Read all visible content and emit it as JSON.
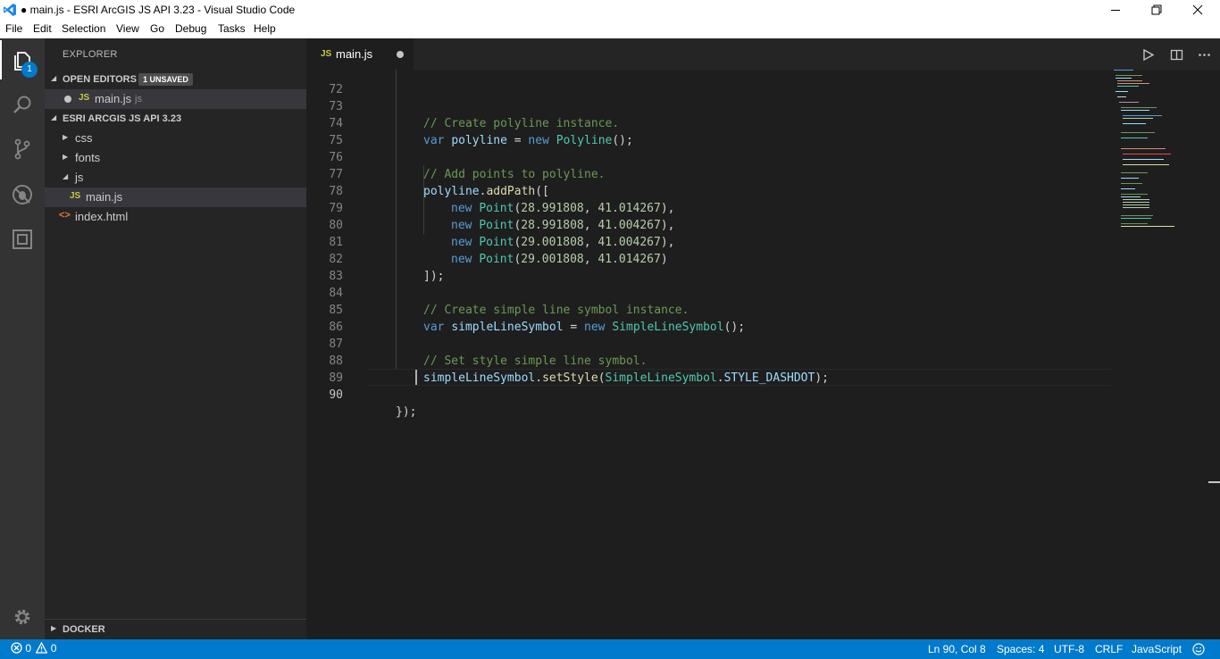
{
  "window": {
    "title": "● main.js - ESRI ArcGIS JS API 3.23 - Visual Studio Code"
  },
  "menu": [
    "File",
    "Edit",
    "Selection",
    "View",
    "Go",
    "Debug",
    "Tasks",
    "Help"
  ],
  "activity": {
    "explorer_badge": "1",
    "icons": [
      "files-icon",
      "search-icon",
      "source-control-icon",
      "debug-icon",
      "extensions-icon",
      "gear-icon"
    ]
  },
  "sidebar": {
    "title": "EXPLORER",
    "open_editors": {
      "label": "OPEN EDITORS",
      "badge": "1 UNSAVED",
      "files": [
        {
          "icon": "JS",
          "name": "main.js",
          "desc": "js"
        }
      ]
    },
    "folder": {
      "label": "ESRI ARCGIS JS API 3.23",
      "items": [
        {
          "name": "css"
        },
        {
          "name": "fonts"
        },
        {
          "name": "js"
        },
        {
          "icon": "JS",
          "name": "main.js"
        },
        {
          "icon": "<>",
          "name": "index.html"
        }
      ]
    },
    "docker": {
      "label": "DOCKER"
    }
  },
  "tab": {
    "icon": "JS",
    "name": "main.js"
  },
  "code": {
    "line_numbers": [
      "72",
      "73",
      "74",
      "75",
      "76",
      "77",
      "78",
      "79",
      "80",
      "81",
      "82",
      "83",
      "84",
      "85",
      "86",
      "87",
      "88",
      "89",
      "90"
    ],
    "l73_comment": "// Create polyline instance.",
    "l74": {
      "kw": "var",
      "name": "polyline",
      "eq": " = ",
      "new": "new",
      "cls": "Polyline",
      "end": "();"
    },
    "l76_comment": "// Add points to polyline.",
    "l77": {
      "obj": "polyline",
      "dot": ".",
      "fn": "addPath",
      "end": "(["
    },
    "points": [
      {
        "new": "new",
        "cls": "Point",
        "open": "(",
        "a": "28.991808",
        "sep": ", ",
        "b": "41.014267",
        "close": "),"
      },
      {
        "new": "new",
        "cls": "Point",
        "open": "(",
        "a": "28.991808",
        "sep": ", ",
        "b": "41.004267",
        "close": "),"
      },
      {
        "new": "new",
        "cls": "Point",
        "open": "(",
        "a": "29.001808",
        "sep": ", ",
        "b": "41.004267",
        "close": "),"
      },
      {
        "new": "new",
        "cls": "Point",
        "open": "(",
        "a": "29.001808",
        "sep": ", ",
        "b": "41.014267",
        "close": ")"
      }
    ],
    "l82": "]);",
    "l84_comment": "// Create simple line symbol instance.",
    "l85": {
      "kw": "var",
      "name": "simpleLineSymbol",
      "eq": " = ",
      "new": "new",
      "cls": "SimpleLineSymbol",
      "end": "();"
    },
    "l87_comment": "// Set style simple line symbol.",
    "l88": {
      "obj": "simpleLineSymbol",
      "dot": ".",
      "fn": "setStyle",
      "open": "(",
      "cls": "SimpleLineSymbol",
      "dot2": ".",
      "const": "STYLE_DASHDOT",
      "end": ");"
    },
    "l90": "});"
  },
  "status": {
    "errors": "0",
    "warnings": "0",
    "position": "Ln 90, Col 8",
    "spaces": "Spaces: 4",
    "encoding": "UTF-8",
    "eol": "CRLF",
    "language": "JavaScript"
  }
}
